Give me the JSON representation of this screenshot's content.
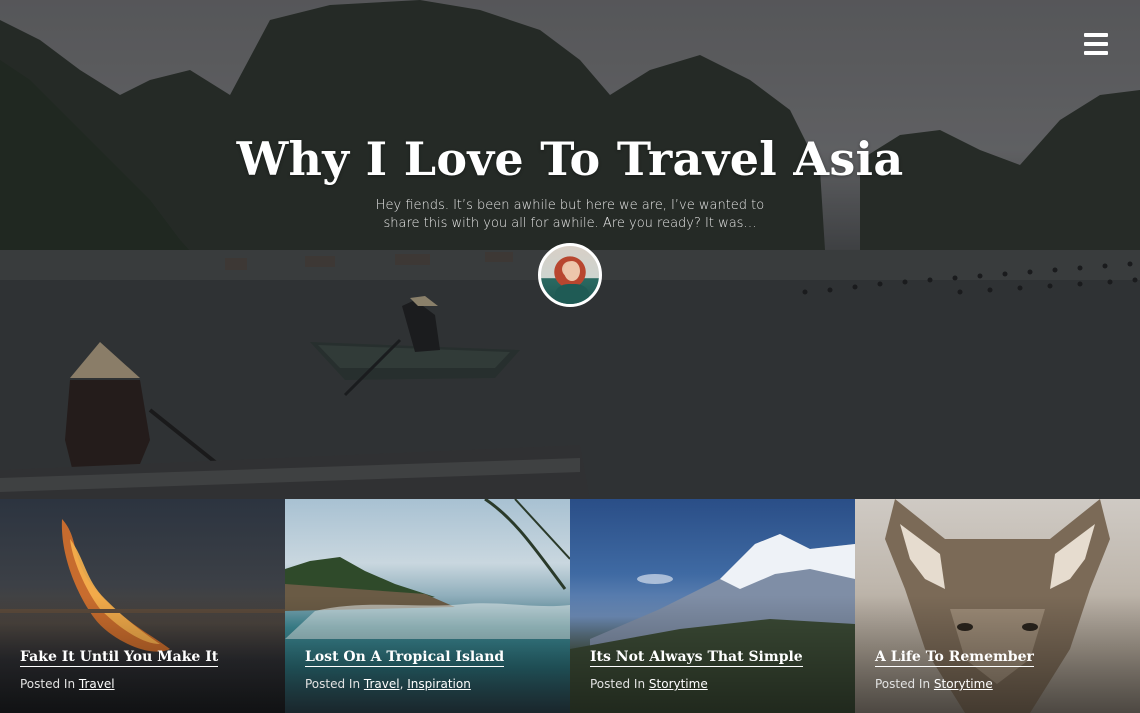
{
  "header": {
    "menu_icon": "hamburger-menu-icon"
  },
  "hero": {
    "title": "Why I Love To Travel Asia",
    "excerpt": "Hey fiends. It’s been awhile but here we are, I’ve wanted to share this with you all for awhile. Are you ready? It was…",
    "avatar_icon": "author-avatar"
  },
  "posts": [
    {
      "title": "Fake It Until You Make It",
      "posted_in_label": "Posted In",
      "categories": [
        "Travel"
      ]
    },
    {
      "title": "Lost On A Tropical Island",
      "posted_in_label": "Posted In",
      "categories": [
        "Travel",
        "Inspiration"
      ],
      "separator": ", "
    },
    {
      "title": "Its Not Always That Simple",
      "posted_in_label": "Posted In",
      "categories": [
        "Storytime"
      ]
    },
    {
      "title": "A Life To Remember",
      "posted_in_label": "Posted In",
      "categories": [
        "Storytime"
      ]
    }
  ],
  "colors": {
    "text": "#ffffff",
    "overlay": "#1c1f22"
  }
}
